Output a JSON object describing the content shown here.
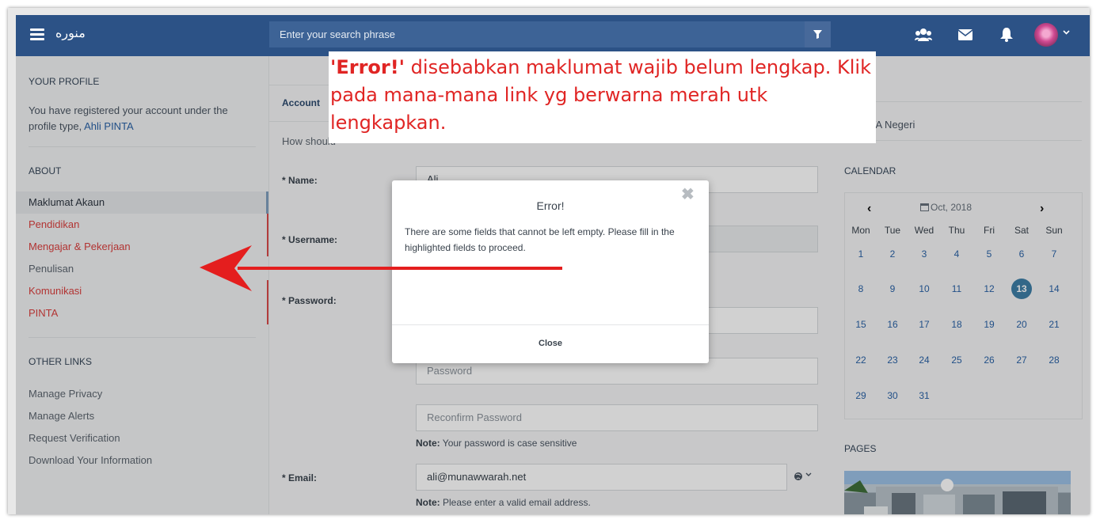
{
  "topbar": {
    "brand": "منوره",
    "search_placeholder": "Enter your search phrase",
    "icons": [
      "menu-icon",
      "filter-icon",
      "users-icon",
      "envelope-icon",
      "bell-icon",
      "avatar",
      "chevron-down-icon"
    ]
  },
  "sidebar": {
    "profile_heading": "YOUR PROFILE",
    "profile_text": "You have registered your account under the profile type,",
    "profile_link": "Ahli PINTA",
    "about_heading": "ABOUT",
    "about_items": [
      {
        "label": "Maklumat Akaun",
        "state": "active"
      },
      {
        "label": "Pendidikan",
        "state": "error"
      },
      {
        "label": "Mengajar & Pekerjaan",
        "state": "error"
      },
      {
        "label": "Penulisan",
        "state": "normal"
      },
      {
        "label": "Komunikasi",
        "state": "error"
      },
      {
        "label": "PINTA",
        "state": "error"
      }
    ],
    "other_heading": "OTHER LINKS",
    "other_links": [
      "Manage Privacy",
      "Manage Alerts",
      "Request Verification",
      "Download Your Information"
    ]
  },
  "main": {
    "tab_label": "Account",
    "intro_text": "How should",
    "name_label": "* Name:",
    "name_value": "Ali",
    "username_label": "* Username:",
    "password_label": "* Password:",
    "password_placeholder": "Password",
    "reconfirm_placeholder": "Reconfirm Password",
    "password_note_label": "Note:",
    "password_note": "Your password is case sensitive",
    "email_label": "* Email:",
    "email_value": "ali@munawwarah.net",
    "email_note_label": "Note:",
    "email_note": "Please enter a valid email address."
  },
  "right": {
    "profile_text": "g PINTA Negeri",
    "calendar_heading": "CALENDAR",
    "calendar_month": "Oct, 2018",
    "prev_label": "‹",
    "next_label": "›",
    "weekdays": [
      "Mon",
      "Tue",
      "Wed",
      "Thu",
      "Fri",
      "Sat",
      "Sun"
    ],
    "weeks": [
      [
        "1",
        "2",
        "3",
        "4",
        "5",
        "6",
        "7"
      ],
      [
        "8",
        "9",
        "10",
        "11",
        "12",
        "13",
        "14"
      ],
      [
        "15",
        "16",
        "17",
        "18",
        "19",
        "20",
        "21"
      ],
      [
        "22",
        "23",
        "24",
        "25",
        "26",
        "27",
        "28"
      ],
      [
        "29",
        "30",
        "31",
        "",
        "",
        "",
        ""
      ]
    ],
    "today": "13",
    "pages_heading": "PAGES"
  },
  "modal": {
    "title": "Error!",
    "message": "There are some fields that cannot be left empty. Please fill in the highlighted fields to proceed.",
    "close_label": "Close",
    "close_glyph": "✖"
  },
  "annotation": {
    "text_bold": "'Error!'",
    "text_rest": " disebabkan maklumat wajib belum lengkap. Klik pada mana-mana   link yg berwarna merah utk lengkapkan."
  },
  "colors": {
    "topbar": "#2c5286",
    "error_red": "#d9403f",
    "annotation_red": "#e02524",
    "today_circle": "#3d7ea6"
  }
}
